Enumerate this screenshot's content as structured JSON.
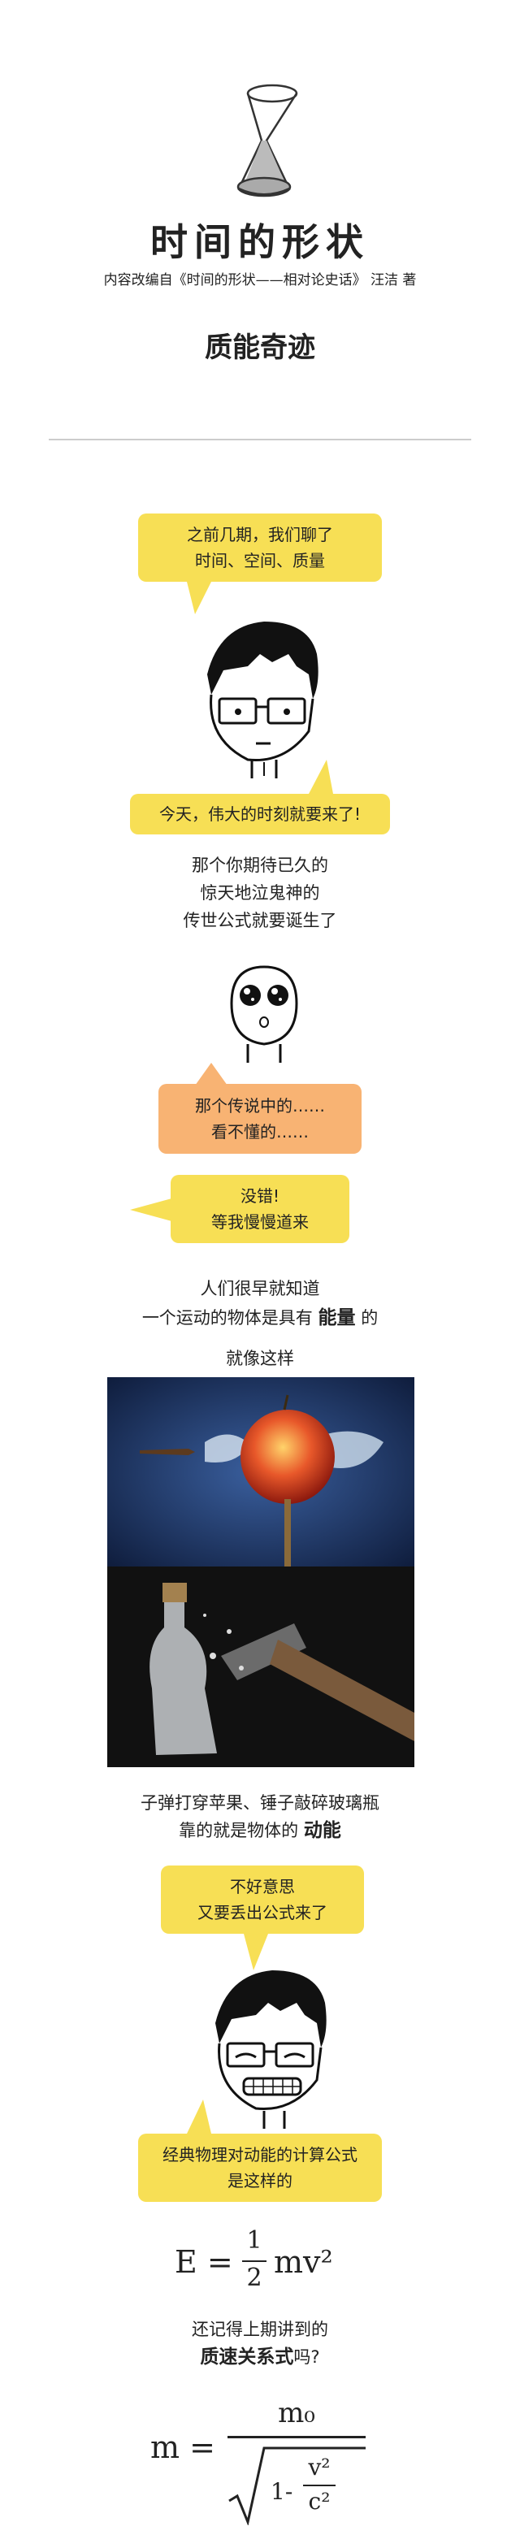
{
  "header": {
    "title": "时间的形状",
    "credit": "内容改编自《时间的形状——相对论史话》 汪洁 著",
    "chapter": "质能奇迹"
  },
  "bubbles": {
    "b1": [
      "之前几期，我们聊了",
      "时间、空间、质量"
    ],
    "b2": "今天，伟大的时刻就要来了!",
    "b3": [
      "那个传说中的……",
      "看不懂的……"
    ],
    "b4": [
      "没错!",
      "等我慢慢道来"
    ],
    "b5": [
      "不好意思",
      "又要丢出公式来了"
    ],
    "b6": [
      "经典物理对动能的计算公式",
      "是这样的"
    ]
  },
  "paragraphs": {
    "p1": [
      "那个你期待已久的",
      "惊天地泣鬼神的",
      "传世公式就要诞生了"
    ],
    "p2_line1": "人们很早就知道",
    "p2_line2_pre": "一个运动的物体是具有",
    "p2_line2_hl": "能量",
    "p2_line2_post": "的",
    "p2_line3": "就像这样",
    "p3_line1": "子弹打穿苹果、锤子敲碎玻璃瓶",
    "p3_line2_pre": "靠的就是物体的",
    "p3_line2_hl": "动能",
    "p4_line1": "还记得上期讲到的",
    "p4_line2_hl": "质速关系式",
    "p4_line2_post": "吗?"
  },
  "formulas": {
    "kinetic": {
      "lhs": "E =",
      "num": "1",
      "den": "2",
      "rhs": "mv²"
    },
    "mass_velocity": {
      "lhs": "m =",
      "num": "m₀",
      "root_one": "1-",
      "v": "v²",
      "c": "c²"
    }
  },
  "colors": {
    "yellow": "#f7df55",
    "orange": "#f8b373",
    "divider": "#cccccc"
  }
}
